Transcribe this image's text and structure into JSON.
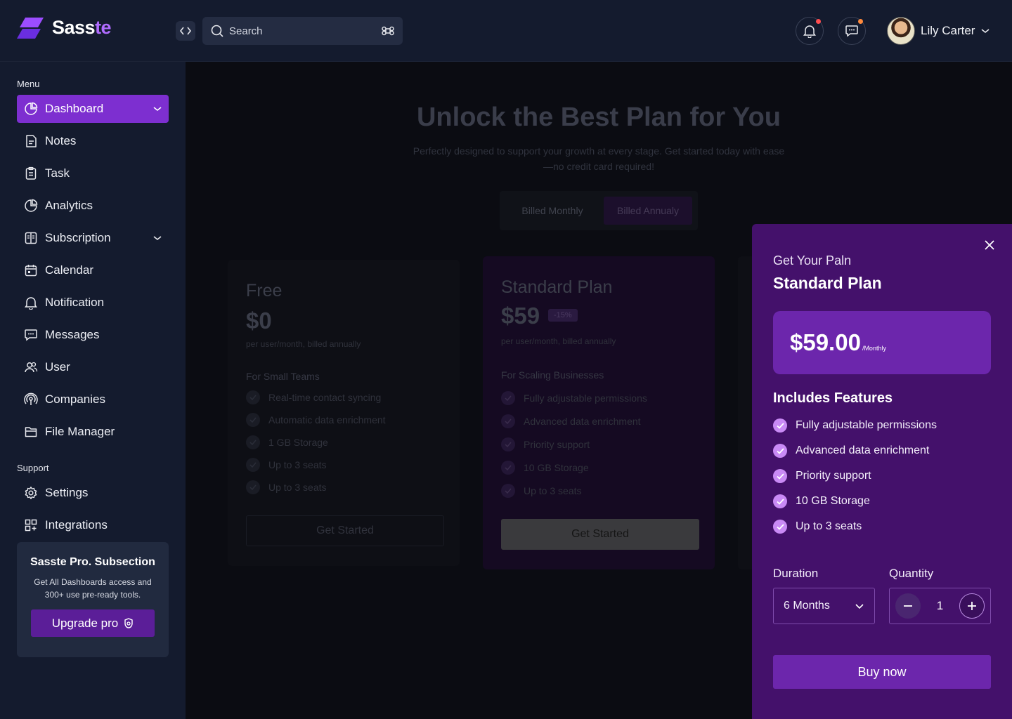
{
  "brand": {
    "name_main": "Sass",
    "name_accent": "te",
    "accent_color": "#b06cff"
  },
  "header": {
    "search_placeholder": "Search",
    "user_name": "Lily Carter",
    "notification_dot_color": "#ff4d4f",
    "message_dot_color": "#ff8a3d"
  },
  "sidebar": {
    "menu_label": "Menu",
    "support_label": "Support",
    "items": [
      {
        "label": "Dashboard",
        "icon": "pie-chart-icon",
        "active": true,
        "expandable": true
      },
      {
        "label": "Notes",
        "icon": "note-icon"
      },
      {
        "label": "Task",
        "icon": "clipboard-icon"
      },
      {
        "label": "Analytics",
        "icon": "pie-chart-icon"
      },
      {
        "label": "Subscription",
        "icon": "layout-icon",
        "expandable": true
      },
      {
        "label": "Calendar",
        "icon": "calendar-icon"
      },
      {
        "label": "Notification",
        "icon": "bell-icon"
      },
      {
        "label": "Messages",
        "icon": "chat-icon"
      },
      {
        "label": "User",
        "icon": "users-icon"
      },
      {
        "label": "Companies",
        "icon": "broadcast-icon"
      },
      {
        "label": "File Manager",
        "icon": "folder-icon"
      }
    ],
    "support_items": [
      {
        "label": "Settings",
        "icon": "gear-icon"
      },
      {
        "label": "Integrations",
        "icon": "grid-plus-icon"
      }
    ],
    "promo": {
      "title": "Sasste Pro. Subsection",
      "text": "Get All Dashboards access and 300+ use pre-ready tools.",
      "button": "Upgrade pro"
    },
    "active_color": "#7d2fd0"
  },
  "main": {
    "title": "Unlock the Best Plan for You",
    "subtitle": "Perfectly designed to support your growth at every stage. Get started today with ease—no credit card required!",
    "billing": {
      "monthly": "Billed Monthly",
      "annually": "Billed Annualy",
      "selected": "annually"
    },
    "plans": [
      {
        "name": "Free",
        "price": "$0",
        "note": "per user/month, billed annually",
        "section": "For Small Teams",
        "features": [
          "Real-time contact syncing",
          "Automatic data enrichment",
          "1 GB Storage",
          "Up to 3 seats",
          "Up to 3 seats"
        ],
        "button": "Get Started"
      },
      {
        "name": "Standard Plan",
        "price": "$59",
        "badge": "-15%",
        "note": "per user/month, billed annually",
        "section": "For Scaling Businesses",
        "features": [
          "Fully adjustable permissions",
          "Advanced data enrichment",
          "Priority support",
          "10 GB Storage",
          "Up to 3 seats"
        ],
        "button": "Get Started"
      }
    ]
  },
  "panel": {
    "kicker": "Get Your Paln",
    "title": "Standard Plan",
    "price": "$59.00",
    "price_unit": "/Monthly",
    "features_title": "Includes Features",
    "features": [
      "Fully adjustable permissions",
      "Advanced data enrichment",
      "Priority support",
      "10 GB Storage",
      "Up to 3 seats"
    ],
    "duration_label": "Duration",
    "duration_value": "6 Months",
    "quantity_label": "Quantity",
    "quantity_value": "1",
    "buy_button": "Buy now",
    "background_color": "#44116b"
  }
}
